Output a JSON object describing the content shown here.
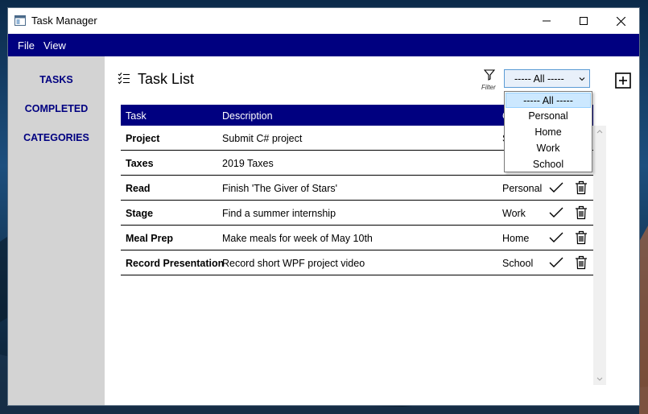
{
  "window": {
    "title": "Task Manager"
  },
  "menu": {
    "items": [
      "File",
      "View"
    ]
  },
  "sidebar": {
    "items": [
      "TASKS",
      "COMPLETED",
      "CATEGORIES"
    ]
  },
  "main": {
    "title": "Task List",
    "filter_label": "Filter",
    "category_filter": {
      "selected": "----- All -----",
      "options": [
        "----- All -----",
        "Personal",
        "Home",
        "Work",
        "School"
      ]
    }
  },
  "table": {
    "columns": [
      "Task",
      "Description",
      "C"
    ],
    "rows": [
      {
        "task": "Project",
        "description": "Submit C# project",
        "category": "S"
      },
      {
        "task": "Taxes",
        "description": "2019 Taxes",
        "category": ""
      },
      {
        "task": "Read",
        "description": "Finish 'The Giver of Stars'",
        "category": "Personal"
      },
      {
        "task": "Stage",
        "description": "Find a summer internship",
        "category": "Work"
      },
      {
        "task": "Meal Prep",
        "description": "Make meals for week of May 10th",
        "category": "Home"
      },
      {
        "task": "Record Presentation",
        "description": "Record short WPF project video",
        "category": "School"
      }
    ]
  },
  "colors": {
    "accent": "#000080",
    "sidebar": "#d3d3d3",
    "selection": "#cce8ff"
  }
}
